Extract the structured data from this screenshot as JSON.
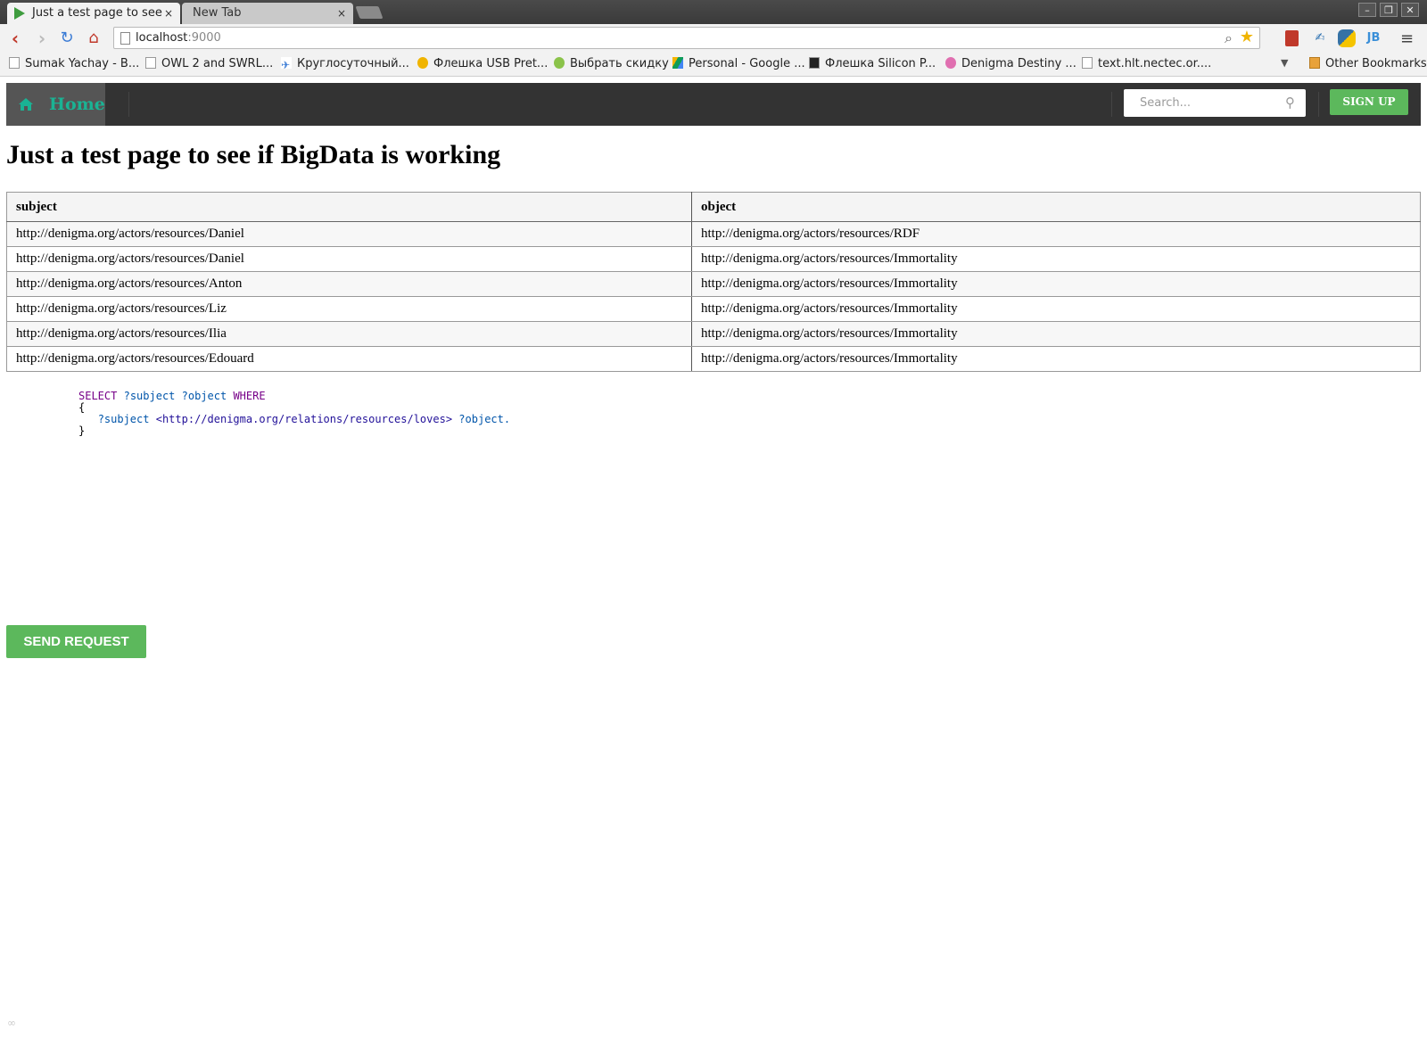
{
  "browser": {
    "tabs": [
      {
        "title": "Just a test page to see",
        "close": "×"
      },
      {
        "title": "New Tab",
        "close": "×"
      }
    ],
    "window_controls": [
      "–",
      "❐",
      "✕"
    ],
    "address": {
      "host": "localhost",
      "port": ":9000"
    },
    "bookmarks": [
      "Sumak Yachay - B...",
      "OWL 2 and SWRL...",
      "Круглосуточный...",
      "Флешка USB Pret...",
      "Выбрать скидку",
      "Personal - Google ...",
      "Флешка Silicon P...",
      "Denigma Destiny ...",
      "text.hlt.nectec.or....",
      "Other Bookmarks"
    ],
    "extensions": [
      "JB"
    ]
  },
  "navbar": {
    "home_label": "Home",
    "search_placeholder": "Search...",
    "signup_label": "SIGN UP"
  },
  "page": {
    "title": "Just a test page to see if BigData is working",
    "table": {
      "columns": [
        "subject",
        "object"
      ],
      "rows": [
        [
          "http://denigma.org/actors/resources/Daniel",
          "http://denigma.org/actors/resources/RDF"
        ],
        [
          "http://denigma.org/actors/resources/Daniel",
          "http://denigma.org/actors/resources/Immortality"
        ],
        [
          "http://denigma.org/actors/resources/Anton",
          "http://denigma.org/actors/resources/Immortality"
        ],
        [
          "http://denigma.org/actors/resources/Liz",
          "http://denigma.org/actors/resources/Immortality"
        ],
        [
          "http://denigma.org/actors/resources/Ilia",
          "http://denigma.org/actors/resources/Immortality"
        ],
        [
          "http://denigma.org/actors/resources/Edouard",
          "http://denigma.org/actors/resources/Immortality"
        ]
      ]
    },
    "query": {
      "select_kw": "SELECT",
      "subject_var": "?subject",
      "object_var": "?object",
      "where_kw": "WHERE",
      "open_brace": "{",
      "predicate_uri": "<http://denigma.org/relations/resources/loves>",
      "terminator": ".",
      "close_brace": "}"
    },
    "send_button_label": "SEND REQUEST"
  },
  "colors": {
    "navbar_bg": "#333333",
    "home_bg": "#555555",
    "accent_teal": "#1ab394",
    "button_green": "#5cb85c"
  }
}
